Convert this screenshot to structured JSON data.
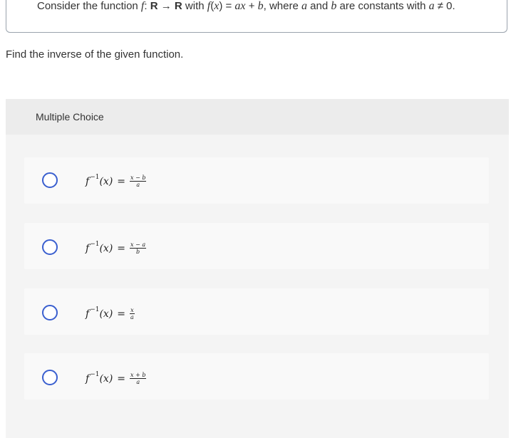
{
  "prompt": {
    "p1": "Consider the function ",
    "f": "f",
    "p2": ": ",
    "R1": "R",
    "arrow": " → ",
    "R2": "R",
    "p3": " with ",
    "fx": "f",
    "p4": "(",
    "x": "x",
    "p5": ") = ",
    "ax": "ax",
    "p6": " + ",
    "b": "b",
    "p7": ", where ",
    "a": "a",
    "p8": " and ",
    "b2": "b",
    "p9": " are constants with ",
    "a2": "a",
    "p10": " ≠ 0."
  },
  "question": "Find the inverse of the given function.",
  "multiple_choice": {
    "title": "Multiple Choice",
    "options": [
      {
        "lhs": "f",
        "sup": "−1",
        "arg": "(x)",
        "eq": "=",
        "num": "x − b",
        "den": "a"
      },
      {
        "lhs": "f",
        "sup": "−1",
        "arg": "(x)",
        "eq": "=",
        "num": "x − a",
        "den": "b"
      },
      {
        "lhs": "f",
        "sup": "−1",
        "arg": "(x)",
        "eq": "=",
        "num": "x",
        "den": "a"
      },
      {
        "lhs": "f",
        "sup": "−1",
        "arg": "(x)",
        "eq": "=",
        "num": "x + b",
        "den": "a"
      }
    ]
  },
  "colors": {
    "radio_border": "#3a5fcf",
    "panel_bg": "#f4f4f4",
    "option_bg": "#f9f9f9"
  }
}
